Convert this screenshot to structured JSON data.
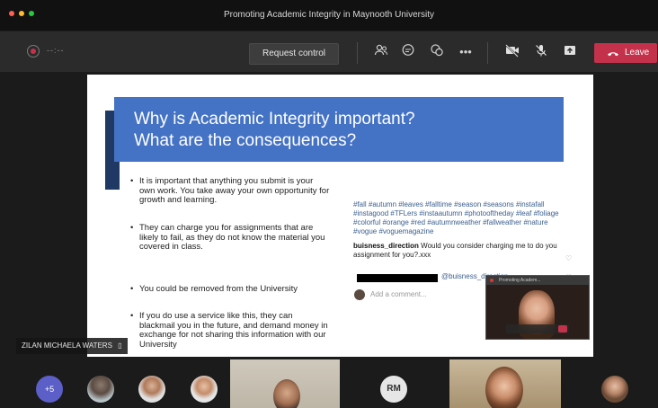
{
  "window": {
    "title": "Promoting Academic Integrity in Maynooth University",
    "traffic_lights": [
      "#ff5f57",
      "#febc2e",
      "#28c840"
    ]
  },
  "toolbar": {
    "timer": "--:--",
    "request_control": "Request control",
    "icons": [
      "participants-icon",
      "chat-icon",
      "reactions-icon",
      "more-options-icon",
      "camera-off-icon",
      "mic-off-icon",
      "share-tray-icon"
    ],
    "leave_label": "Leave",
    "leave_color": "#c4314b"
  },
  "slide": {
    "heading_line1": "Why is Academic Integrity important?",
    "heading_line2": "What are the consequences?",
    "banner_color": "#4472c4",
    "bullets": [
      "It is important that anything you submit is your own work. You take away your own opportunity for growth and learning.",
      "They can charge you for assignments that are likely to fail, as they do not know the material you covered in class.",
      "You could be removed from the University",
      "If you do use a service like this, they can blackmail you in the future, and demand money in exchange for not sharing this information with our University"
    ],
    "instagram": {
      "hashtags": "#fall #autumn #leaves #falltime #season #seasons #instafall #instagood #TFLers #instaautumn #photooftheday #leaf #foliage #colorful #orange #red #autumnweather #fallweather #nature #vogue #voguemagazine",
      "comment_user": "buisness_direction",
      "comment_text": "Would you consider charging me to do you assignment for you?.xxx",
      "reply_handle": "@buisness_direction",
      "add_comment": "Add a comment..."
    }
  },
  "mini_window": {
    "title": "Promoting Academ..."
  },
  "presenter_label": "ZILAN MICHAELA WATERS",
  "participants": {
    "overflow_count": "+5",
    "initials": "RM"
  }
}
